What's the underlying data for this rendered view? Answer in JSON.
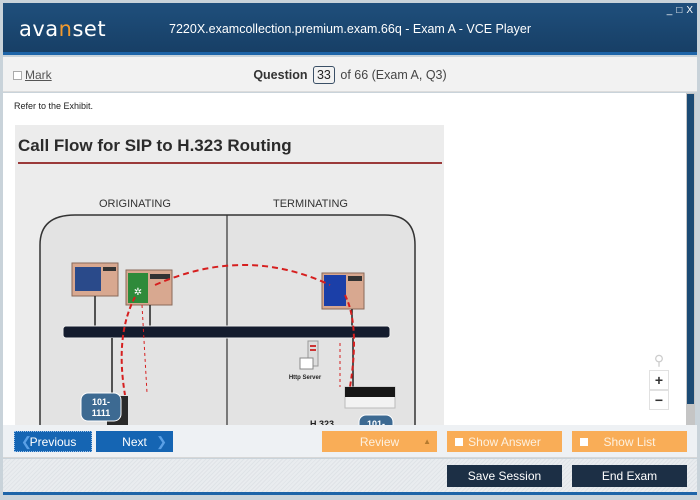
{
  "titlebar": {
    "logo_prefix": "ava",
    "logo_accent": "n",
    "logo_suffix": "set",
    "title": "7220X.examcollection.premium.exam.66q - Exam A - VCE Player",
    "controls": {
      "minimize": "_",
      "maximize": "□",
      "close": "X"
    }
  },
  "question_bar": {
    "mark_label": "Mark",
    "question_label": "Question",
    "question_number": "33",
    "question_suffix": "of 66 (Exam A, Q3)"
  },
  "content": {
    "instruction": "Refer to the Exhibit.",
    "exhibit": {
      "title": "Call Flow for SIP to H.323 Routing",
      "section_left": "ORIGINATING",
      "section_right": "TERMINATING",
      "extension_left": [
        "101-",
        "1111"
      ],
      "extension_right": "101-",
      "http_server_label": "Http Server",
      "h323_label": "H.323"
    }
  },
  "zoom": {
    "search_icon": "⚲",
    "zoom_in": "+",
    "zoom_out": "−"
  },
  "navigation": {
    "previous_label": "Previous",
    "next_label": "Next",
    "review_label": "Review",
    "show_answer_label": "Show Answer",
    "show_list_label": "Show List"
  },
  "footer": {
    "save_session_label": "Save Session",
    "end_exam_label": "End Exam"
  },
  "colors": {
    "titlebar": "#1f4f7c",
    "primary_button": "#1565b3",
    "orange_button": "#f9ad57",
    "dark_button": "#1c2f45",
    "logo_accent": "#f29a2e"
  }
}
